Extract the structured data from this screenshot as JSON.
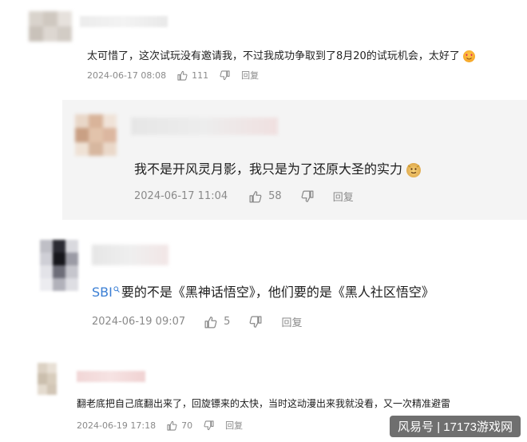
{
  "comments": [
    {
      "text": "太可惜了，这次试玩没有邀请我，不过我成功争取到了8月20的试玩机会，太好了",
      "emoji": "heart-eyes-emoji",
      "timestamp": "2024-06-17 08:08",
      "likes": "111",
      "reply_label": "回复"
    },
    {
      "text": "我不是开风灵月影，我只是为了还原大圣的实力",
      "emoji": "monkey-emoji",
      "timestamp": "2024-06-17 11:04",
      "likes": "58",
      "reply_label": "回复"
    },
    {
      "tag": "SBI",
      "text": "要的不是《黑神话悟空》，他们要的是《黑人社区悟空》",
      "timestamp": "2024-06-19 09:07",
      "likes": "5",
      "reply_label": "回复"
    },
    {
      "text": "翻老底把自己底翻出来了，回旋镖来的太快，当时这动漫出来我就没看，又一次精准避雷",
      "timestamp": "2024-06-19 17:18",
      "likes": "70",
      "reply_label": "回复"
    }
  ],
  "watermark": "风易号 | 17173游戏网",
  "colors": {
    "link_tag": "#3b7fd4",
    "meta_text": "#8a8a8a",
    "reply_bg": "#f4f4f4"
  }
}
